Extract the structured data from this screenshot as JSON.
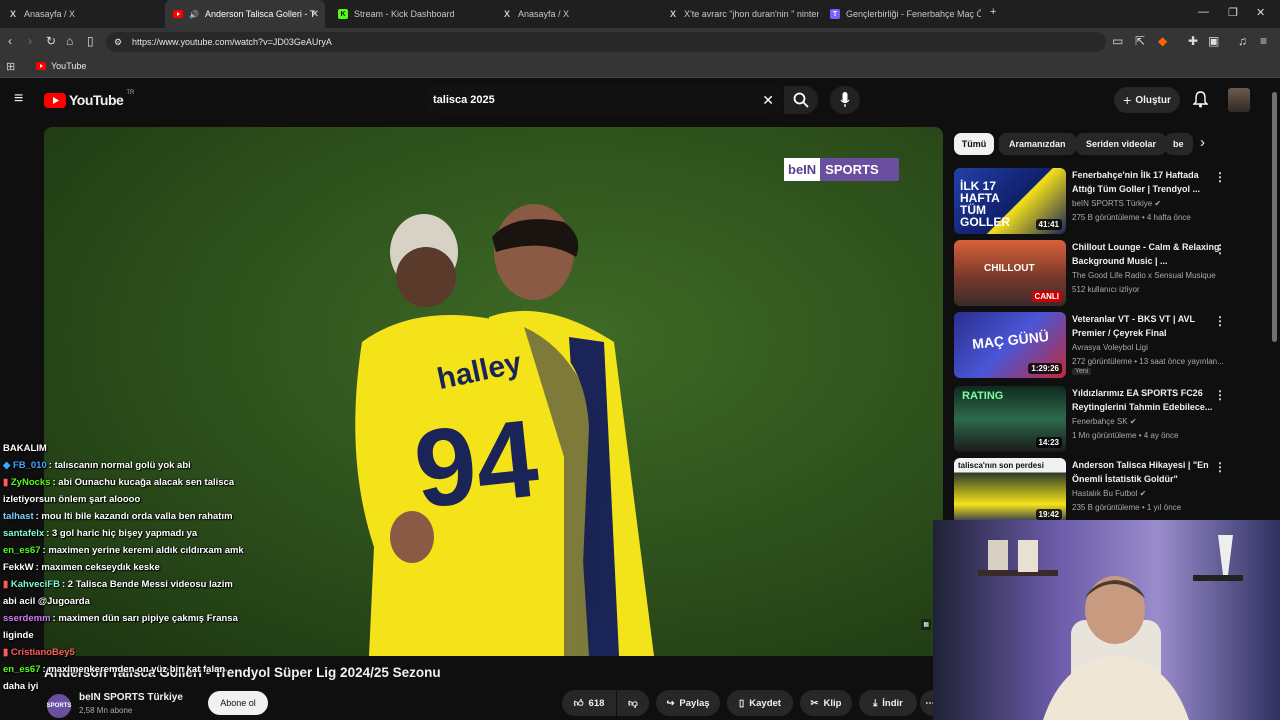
{
  "browser": {
    "tabs": [
      {
        "label": "Anasayfa / X",
        "icon": "X"
      },
      {
        "label": "Anderson Talisca Golleri - Tre",
        "icon": "YT"
      },
      {
        "label": "Stream - Kick Dashboard",
        "icon": "K"
      },
      {
        "label": "Anasayfa / X",
        "icon": "X"
      },
      {
        "label": "X'te avrarc \"jhon duran'nin \" nintend",
        "icon": "X"
      },
      {
        "label": "Gençlerbirliği - Fenerbahçe Maç Özet",
        "icon": "T"
      }
    ],
    "url": "https://www.youtube.com/watch?v=JD03GeAUryA",
    "bookmark": "YouTube"
  },
  "youtube": {
    "logo": "YouTube",
    "logo_region": "TR",
    "search_value": "talisca 2025",
    "create_label": "Oluştur"
  },
  "video": {
    "overlay_logo_a": "beIN",
    "overlay_logo_b": "SPORTS",
    "title": "Anderson Talisca Golleri - Trendyol Süper Lig 2024/25 Sezonu",
    "channel": "beIN SPORTS Türkiye",
    "subscribers": "2,58 Mn abone",
    "subscribe_label": "Abone ol",
    "likes": "618",
    "share_label": "Paylaş",
    "save_label": "Kaydet",
    "clip_label": "Klip",
    "download_label": "İndir"
  },
  "chips": [
    {
      "label": "Tümü",
      "selected": true
    },
    {
      "label": "Aramanızdan",
      "selected": false
    },
    {
      "label": "Seriden videolar",
      "selected": false
    },
    {
      "label": "be",
      "selected": false
    }
  ],
  "recommendations": [
    {
      "title": "Fenerbahçe'nin İlk 17 Haftada Attığı Tüm Goller | Trendyol ...",
      "channel": "beIN SPORTS Türkiye",
      "stats": "275 B görüntüleme • 4 hafta önce",
      "badge": "41:41",
      "thumb_text": "İLK 17 HAFTA TÜM GOLLER"
    },
    {
      "title": "Chillout Lounge - Calm & Relaxing Background Music | ...",
      "channel": "The Good Life Radio x Sensual Musique",
      "stats": "512 kullanıcı izliyor",
      "badge": "CANLI",
      "thumb_text": "CHILLOUT"
    },
    {
      "title": "Veteranlar VT - BKS VT | AVL Premier / Çeyrek Final",
      "channel": "Avrasya Voleybol Ligi",
      "stats": "272 görüntüleme • 13 saat önce yayınlan...",
      "badge": "1:29:26",
      "thumb_text": "MAÇ GÜNÜ",
      "extra": "Yeni"
    },
    {
      "title": "Yıldızlarımız EA SPORTS FC26 Reytinglerini Tahmin Edebilece...",
      "channel": "Fenerbahçe SK",
      "stats": "1 Mn görüntüleme • 4 ay önce",
      "badge": "14:23",
      "thumb_text": "RATING"
    },
    {
      "title": "Anderson Talisca Hikayesi | \"En Önemli İstatistik Goldür\"",
      "channel": "Hastalık Bu Futbol",
      "stats": "235 B görüntüleme • 1 yıl önce",
      "badge": "19:42",
      "thumb_text": "talisca'nın son perdesi"
    }
  ],
  "chat": {
    "header": "BAKALIM",
    "messages": [
      {
        "user": "FB_010",
        "text": ": talıscanın normal golü yok abi",
        "color": "#3ea6ff"
      },
      {
        "user": "ZyNocks",
        "text": ": abi Ounachu kucağa alacak sen talisca izletiyorsun önlem şart aloooo",
        "color": "#53fc18"
      },
      {
        "user": "talhast",
        "text": ": mou lti bile kazandı orda valla ben rahatım",
        "color": "#7fd1ff"
      },
      {
        "user": "santafelx",
        "text": ": 3 gol haric hiç bişey yapmadı ya",
        "color": "#7fffd4"
      },
      {
        "user": "en_es67",
        "text": ": maximen yerine keremi aldık cıldırxam amk",
        "color": "#53fc18"
      },
      {
        "user": "FekkW",
        "text": ": maxımen cekseydık keske",
        "color": "#ffffff"
      },
      {
        "user": "KahveciFB",
        "text": ": 2 Talisca Bende Messi videosu lazim abi acil @Jugoarda",
        "color": "#7fffd4"
      },
      {
        "user": "sserdemm",
        "text": ": maximen dün sarı pipiye çakmış Fransa liginde",
        "color": "#d07cff"
      },
      {
        "user": "CristianoBey5",
        "text": "",
        "color": "#ff5c5c"
      },
      {
        "user": "en_es67",
        "text": ": maximenkeremden on yüz bin kat falan daha iyi",
        "color": "#53fc18"
      }
    ]
  }
}
